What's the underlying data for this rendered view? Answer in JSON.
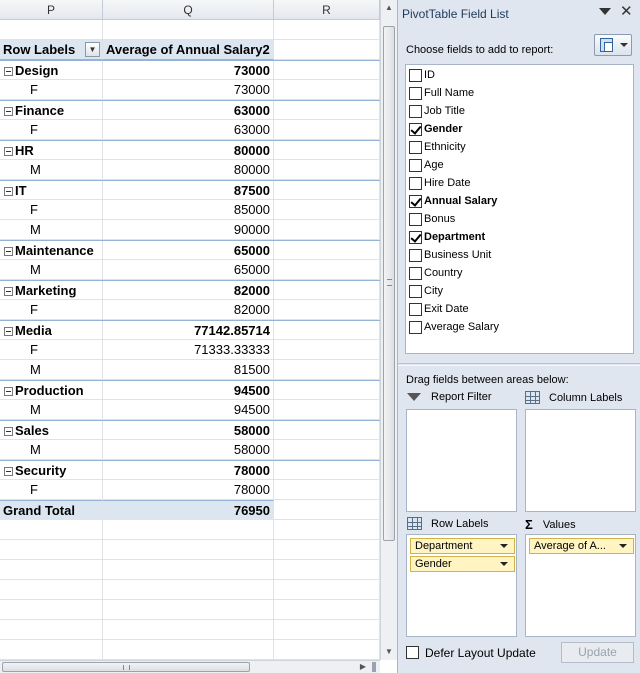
{
  "sheet": {
    "columns": [
      "P",
      "Q",
      "R"
    ],
    "pivot_header": {
      "row_labels": "Row Labels",
      "value_header": "Average of Annual Salary2"
    },
    "rows": [
      {
        "type": "dept",
        "label": "Design",
        "value": "73000"
      },
      {
        "type": "sub",
        "label": "F",
        "value": "73000"
      },
      {
        "type": "dept",
        "label": "Finance",
        "value": "63000"
      },
      {
        "type": "sub",
        "label": "F",
        "value": "63000"
      },
      {
        "type": "dept",
        "label": "HR",
        "value": "80000"
      },
      {
        "type": "sub",
        "label": "M",
        "value": "80000"
      },
      {
        "type": "dept",
        "label": "IT",
        "value": "87500"
      },
      {
        "type": "sub",
        "label": "F",
        "value": "85000"
      },
      {
        "type": "sub",
        "label": "M",
        "value": "90000"
      },
      {
        "type": "dept",
        "label": "Maintenance",
        "value": "65000"
      },
      {
        "type": "sub",
        "label": "M",
        "value": "65000"
      },
      {
        "type": "dept",
        "label": "Marketing",
        "value": "82000"
      },
      {
        "type": "sub",
        "label": "F",
        "value": "82000"
      },
      {
        "type": "dept",
        "label": "Media",
        "value": "77142.85714"
      },
      {
        "type": "sub",
        "label": "F",
        "value": "71333.33333"
      },
      {
        "type": "sub",
        "label": "M",
        "value": "81500"
      },
      {
        "type": "dept",
        "label": "Production",
        "value": "94500"
      },
      {
        "type": "sub",
        "label": "M",
        "value": "94500"
      },
      {
        "type": "dept",
        "label": "Sales",
        "value": "58000"
      },
      {
        "type": "sub",
        "label": "M",
        "value": "58000"
      },
      {
        "type": "dept",
        "label": "Security",
        "value": "78000"
      },
      {
        "type": "sub",
        "label": "F",
        "value": "78000"
      },
      {
        "type": "grand",
        "label": "Grand Total",
        "value": "76950"
      }
    ]
  },
  "pane": {
    "title": "PivotTable Field List",
    "choose_label": "Choose fields to add to report:",
    "fields": [
      {
        "name": "ID",
        "checked": false
      },
      {
        "name": "Full Name",
        "checked": false
      },
      {
        "name": "Job Title",
        "checked": false
      },
      {
        "name": "Gender",
        "checked": true
      },
      {
        "name": "Ethnicity",
        "checked": false
      },
      {
        "name": "Age",
        "checked": false
      },
      {
        "name": "Hire Date",
        "checked": false
      },
      {
        "name": "Annual Salary",
        "checked": true
      },
      {
        "name": "Bonus",
        "checked": false
      },
      {
        "name": "Department",
        "checked": true
      },
      {
        "name": "Business Unit",
        "checked": false
      },
      {
        "name": "Country",
        "checked": false
      },
      {
        "name": "City",
        "checked": false
      },
      {
        "name": "Exit Date",
        "checked": false
      },
      {
        "name": "Average Salary",
        "checked": false
      }
    ],
    "drag_label": "Drag fields between areas below:",
    "areas": {
      "report_filter": {
        "label": "Report Filter",
        "items": []
      },
      "column_labels": {
        "label": "Column Labels",
        "items": []
      },
      "row_labels": {
        "label": "Row Labels",
        "items": [
          "Department",
          "Gender"
        ]
      },
      "values": {
        "label": "Values",
        "items": [
          "Average of A..."
        ]
      }
    },
    "defer_label": "Defer Layout Update",
    "update_label": "Update"
  }
}
